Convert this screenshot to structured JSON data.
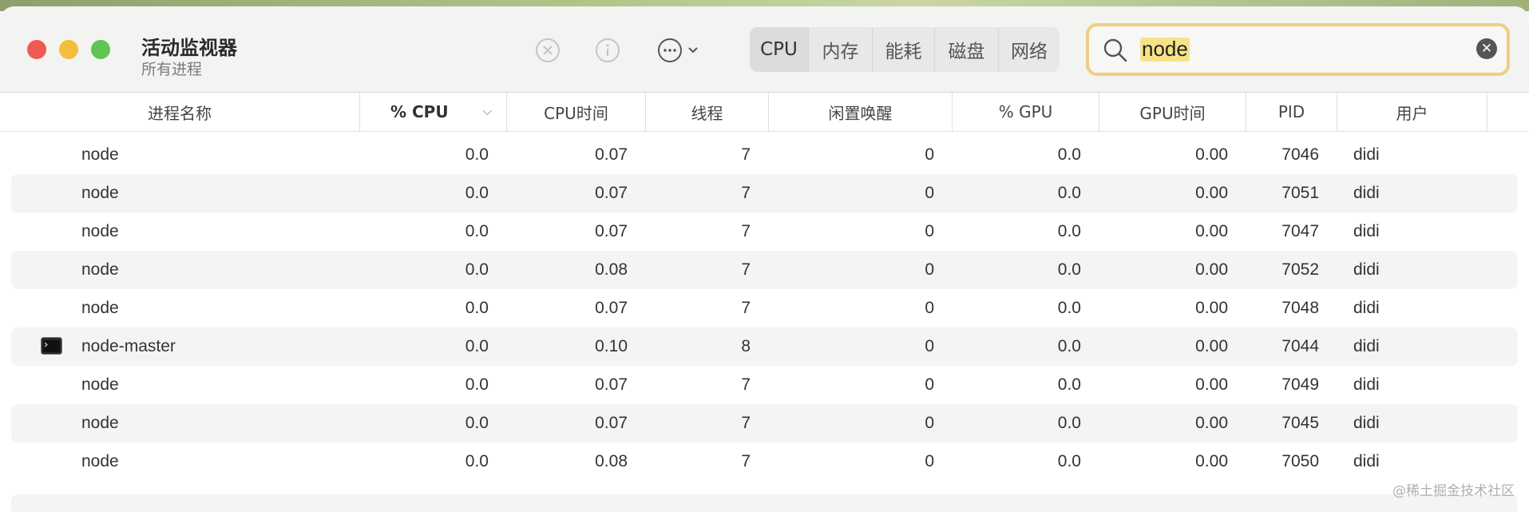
{
  "window": {
    "title": "活动监视器",
    "subtitle": "所有进程"
  },
  "toolbar": {
    "stop_icon": "stop-process-icon",
    "info_icon": "info-icon",
    "more_icon": "more-actions-icon",
    "tabs": [
      {
        "label": "CPU",
        "active": true
      },
      {
        "label": "内存",
        "active": false
      },
      {
        "label": "能耗",
        "active": false
      },
      {
        "label": "磁盘",
        "active": false
      },
      {
        "label": "网络",
        "active": false
      }
    ]
  },
  "search": {
    "value": "node",
    "placeholder": "",
    "highlight_color": "#efcf7e"
  },
  "columns": [
    "进程名称",
    "% CPU",
    "CPU时间",
    "线程",
    "闲置唤醒",
    "% GPU",
    "GPU时间",
    "PID",
    "用户"
  ],
  "rows": [
    {
      "name": "node",
      "cpu": "0.0",
      "cpu_time": "0.07",
      "threads": "7",
      "idle_wakeups": "0",
      "gpu": "0.0",
      "gpu_time": "0.00",
      "pid": "7046",
      "user": "didi",
      "icon": ""
    },
    {
      "name": "node",
      "cpu": "0.0",
      "cpu_time": "0.07",
      "threads": "7",
      "idle_wakeups": "0",
      "gpu": "0.0",
      "gpu_time": "0.00",
      "pid": "7051",
      "user": "didi",
      "icon": ""
    },
    {
      "name": "node",
      "cpu": "0.0",
      "cpu_time": "0.07",
      "threads": "7",
      "idle_wakeups": "0",
      "gpu": "0.0",
      "gpu_time": "0.00",
      "pid": "7047",
      "user": "didi",
      "icon": ""
    },
    {
      "name": "node",
      "cpu": "0.0",
      "cpu_time": "0.08",
      "threads": "7",
      "idle_wakeups": "0",
      "gpu": "0.0",
      "gpu_time": "0.00",
      "pid": "7052",
      "user": "didi",
      "icon": ""
    },
    {
      "name": "node",
      "cpu": "0.0",
      "cpu_time": "0.07",
      "threads": "7",
      "idle_wakeups": "0",
      "gpu": "0.0",
      "gpu_time": "0.00",
      "pid": "7048",
      "user": "didi",
      "icon": ""
    },
    {
      "name": "node-master",
      "cpu": "0.0",
      "cpu_time": "0.10",
      "threads": "8",
      "idle_wakeups": "0",
      "gpu": "0.0",
      "gpu_time": "0.00",
      "pid": "7044",
      "user": "didi",
      "icon": "terminal-icon"
    },
    {
      "name": "node",
      "cpu": "0.0",
      "cpu_time": "0.07",
      "threads": "7",
      "idle_wakeups": "0",
      "gpu": "0.0",
      "gpu_time": "0.00",
      "pid": "7049",
      "user": "didi",
      "icon": ""
    },
    {
      "name": "node",
      "cpu": "0.0",
      "cpu_time": "0.07",
      "threads": "7",
      "idle_wakeups": "0",
      "gpu": "0.0",
      "gpu_time": "0.00",
      "pid": "7045",
      "user": "didi",
      "icon": ""
    },
    {
      "name": "node",
      "cpu": "0.0",
      "cpu_time": "0.08",
      "threads": "7",
      "idle_wakeups": "0",
      "gpu": "0.0",
      "gpu_time": "0.00",
      "pid": "7050",
      "user": "didi",
      "icon": ""
    }
  ],
  "watermark": "@稀土掘金技术社区"
}
